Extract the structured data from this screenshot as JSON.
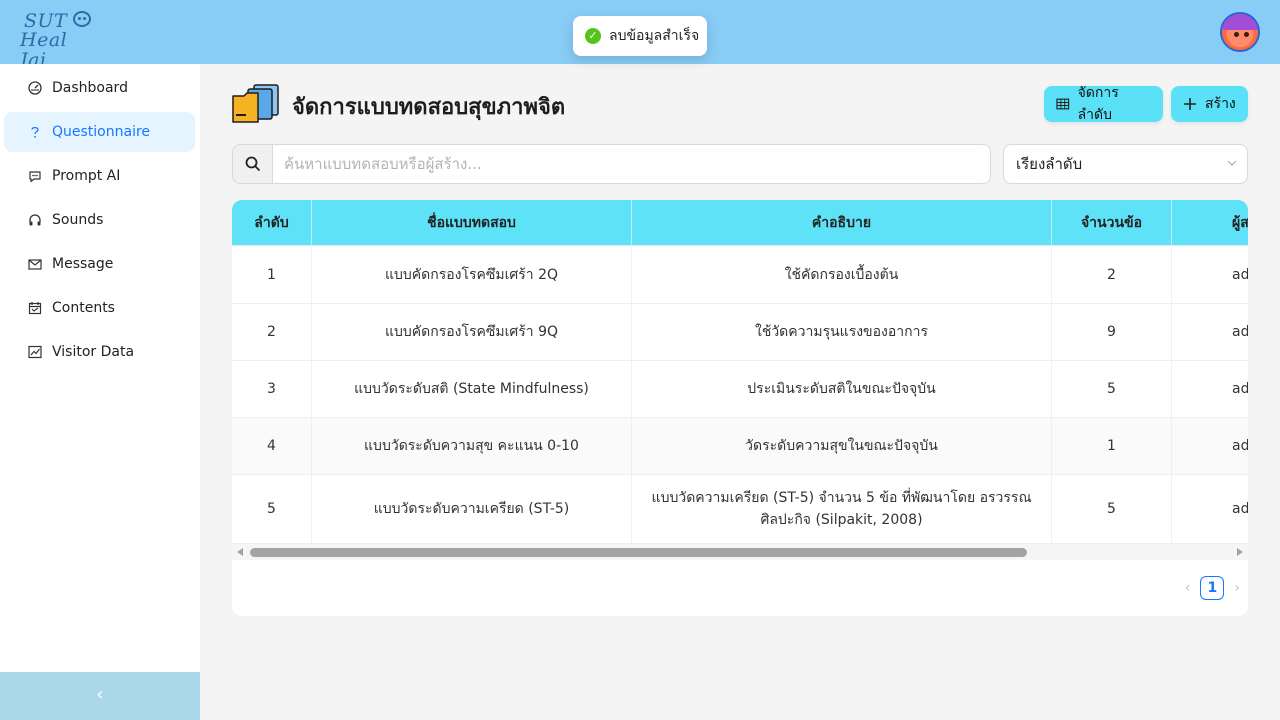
{
  "app": {
    "logo_line1": "SUT",
    "logo_line2": "Heal Jai"
  },
  "toast": {
    "message": "ลบข้อมูลสำเร็จ",
    "icon": "check-circle-icon",
    "color": "#52c41a"
  },
  "sidebar": {
    "items": [
      {
        "label": "Dashboard",
        "icon": "dashboard-icon"
      },
      {
        "label": "Questionnaire",
        "icon": "question-icon",
        "active": true
      },
      {
        "label": "Prompt AI",
        "icon": "chat-icon"
      },
      {
        "label": "Sounds",
        "icon": "headphones-icon"
      },
      {
        "label": "Message",
        "icon": "mail-icon"
      },
      {
        "label": "Contents",
        "icon": "calendar-icon"
      },
      {
        "label": "Visitor Data",
        "icon": "line-chart-icon"
      }
    ],
    "collapse_label": "‹"
  },
  "page": {
    "title": "จัดการแบบทดสอบสุขภาพจิต",
    "order_button": "จัดการลำดับ",
    "create_button": "สร้าง",
    "search_placeholder": "ค้นหาแบบทดสอบหรือผู้สร้าง...",
    "sort_select": "เรียงลำดับ"
  },
  "table": {
    "columns": [
      "ลำดับ",
      "ชื่อแบบทดสอบ",
      "คำอธิบาย",
      "จำนวนข้อ",
      "ผู้สร้าง"
    ],
    "rows": [
      [
        "1",
        "แบบคัดกรองโรคซึมเศร้า 2Q",
        "ใช้คัดกรองเบื้องต้น",
        "2",
        "admin"
      ],
      [
        "2",
        "แบบคัดกรองโรคซึมเศร้า 9Q",
        "ใช้วัดความรุนแรงของอาการ",
        "9",
        "admin"
      ],
      [
        "3",
        "แบบวัดระดับสติ (State Mindfulness)",
        "ประเมินระดับสติในขณะปัจจุบัน",
        "5",
        "admin"
      ],
      [
        "4",
        "แบบวัดระดับความสุข คะแนน 0-10",
        "วัดระดับความสุขในขณะปัจจุบัน",
        "1",
        "admin"
      ],
      [
        "5",
        "แบบวัดระดับความเครียด (ST-5)",
        "แบบวัดความเครียด (ST-5) จำนวน 5 ข้อ ที่พัฒนาโดย อรวรรณ ศิลปะกิจ (Silpakit, 2008)",
        "5",
        "admin"
      ]
    ]
  },
  "pagination": {
    "current": "1",
    "prev": "‹",
    "next": "›"
  },
  "colors": {
    "header": "#87cdf6",
    "accent": "#5ae0f7",
    "active_nav_bg": "#e6f4ff",
    "active_nav_text": "#1677ff"
  }
}
